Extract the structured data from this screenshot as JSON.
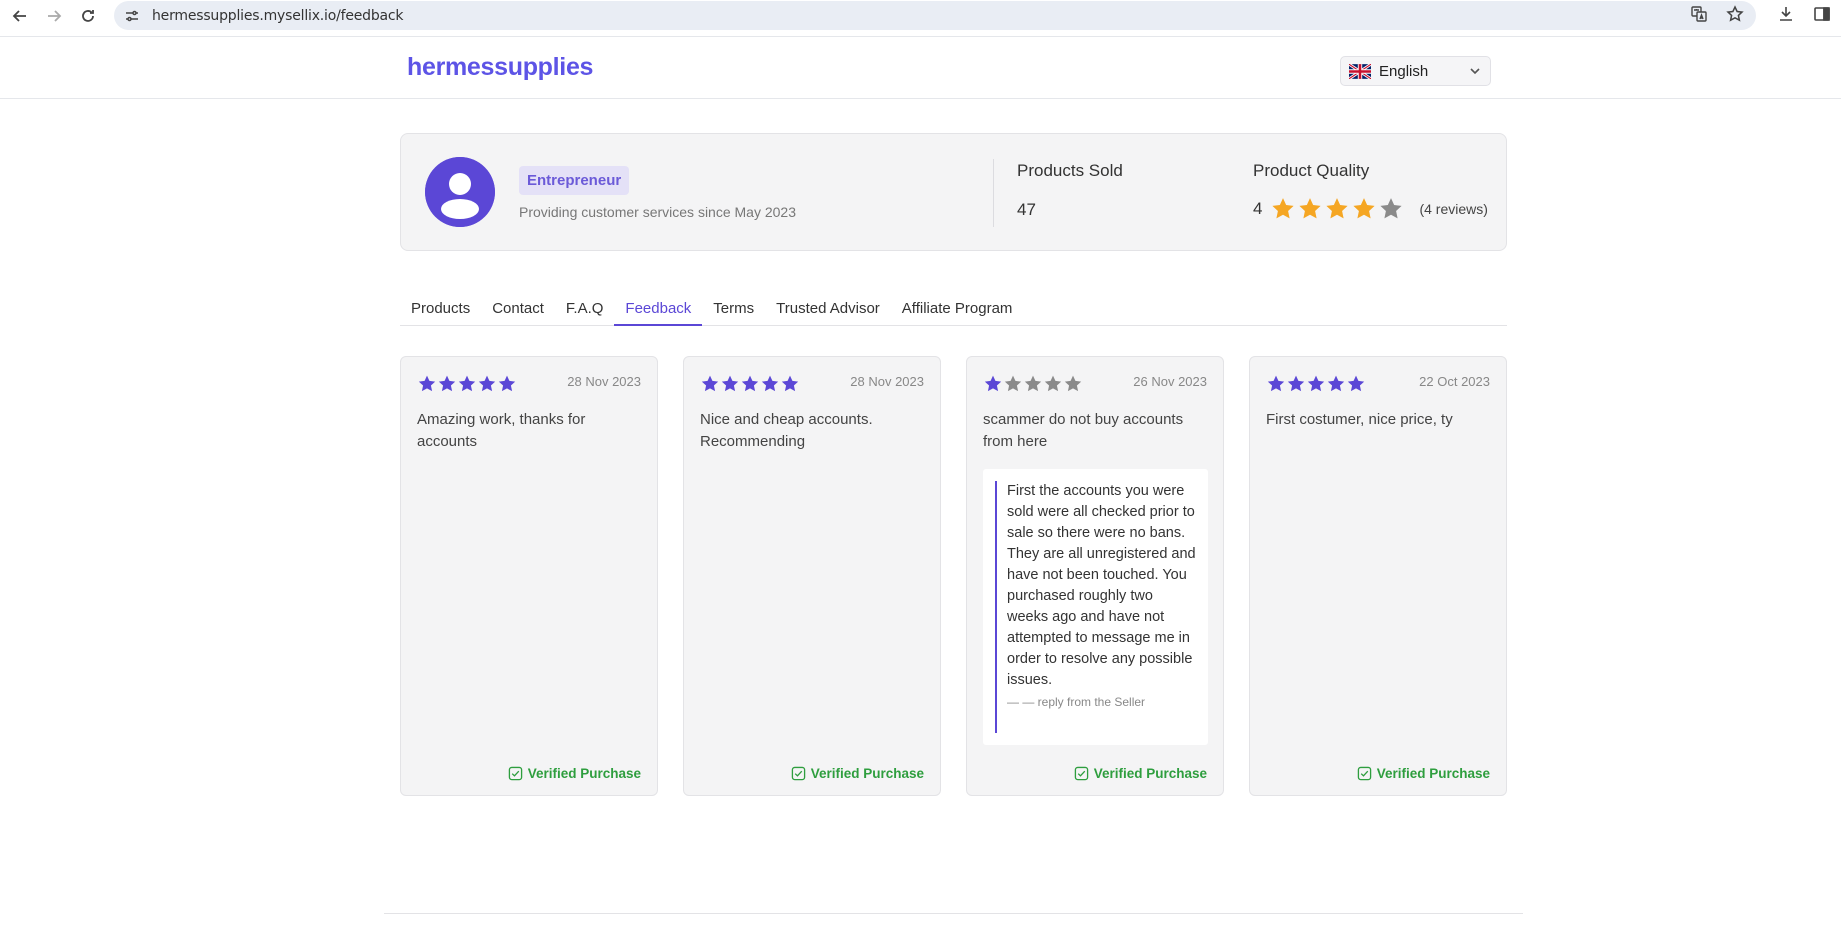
{
  "browser": {
    "url": "hermessupplies.mysellix.io/feedback"
  },
  "header": {
    "brand": "hermessupplies",
    "language": "English"
  },
  "profile": {
    "badge": "Entrepreneur",
    "since": "Providing customer services since May 2023",
    "products_sold_label": "Products Sold",
    "products_sold_value": "47",
    "quality_label": "Product Quality",
    "quality_value": "4",
    "quality_stars_filled": 4,
    "quality_stars_total": 5,
    "reviews": "(4 reviews)"
  },
  "tabs": [
    {
      "label": "Products"
    },
    {
      "label": "Contact"
    },
    {
      "label": "F.A.Q"
    },
    {
      "label": "Feedback",
      "active": true
    },
    {
      "label": "Terms"
    },
    {
      "label": "Trusted Advisor"
    },
    {
      "label": "Affiliate Program"
    }
  ],
  "feedback": [
    {
      "stars": 5,
      "date": "28 Nov 2023",
      "text": "Amazing work, thanks for accounts",
      "verified": "Verified Purchase"
    },
    {
      "stars": 5,
      "date": "28 Nov 2023",
      "text": "Nice and cheap accounts. Recommending",
      "verified": "Verified Purchase"
    },
    {
      "stars": 1,
      "date": "26 Nov 2023",
      "text": "scammer do not buy accounts from here",
      "verified": "Verified Purchase",
      "reply": {
        "text": "First the accounts you were sold were all checked prior to sale so there were no bans. They are all unregistered and have not been touched. You purchased roughly two weeks ago and have not attempted to message me in order to resolve any possible issues.",
        "from": "— — reply from the Seller"
      }
    },
    {
      "stars": 5,
      "date": "22 Oct 2023",
      "text": "First costumer, nice price, ty",
      "verified": "Verified Purchase"
    }
  ],
  "colors": {
    "accent": "#5b47d6",
    "star_gold": "#f5a623",
    "star_gray": "#8a8a8a",
    "verified_green": "#2e9e3e"
  }
}
